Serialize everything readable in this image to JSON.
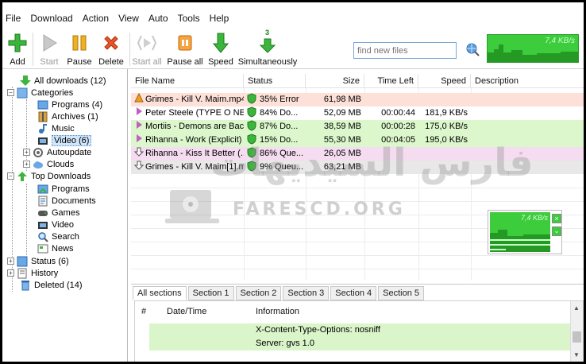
{
  "menu": [
    "File",
    "Download",
    "Action",
    "View",
    "Auto",
    "Tools",
    "Help"
  ],
  "toolbar": {
    "add": "Add",
    "start": "Start",
    "pause": "Pause",
    "delete": "Delete",
    "start_all": "Start all",
    "pause_all": "Pause all",
    "speed": "Speed",
    "simultaneously": "Simultaneously",
    "simultaneous_count": "3",
    "search_placeholder": "find new files",
    "speed_readout": "7,4 KB/s"
  },
  "sidebar": {
    "all_downloads": "All downloads (12)",
    "categories": "Categories",
    "programs": "Programs (4)",
    "archives": "Archives (1)",
    "music": "Music",
    "video": "Video (6)",
    "autoupdate": "Autoupdate",
    "clouds": "Clouds",
    "top_downloads": "Top Downloads",
    "top_programs": "Programs",
    "top_documents": "Documents",
    "top_games": "Games",
    "top_video": "Video",
    "top_search": "Search",
    "top_news": "News",
    "status": "Status (6)",
    "history": "History",
    "deleted": "Deleted (14)"
  },
  "columns": {
    "file_name": "File Name",
    "status": "Status",
    "size": "Size",
    "time_left": "Time Left",
    "speed": "Speed",
    "description": "Description"
  },
  "rows": [
    {
      "name": "Grimes - Kill V. Maim.mp4",
      "status": "35% Error",
      "size": "61,98 MB",
      "time_left": "",
      "speed": "",
      "color": "#fde0d8",
      "state": "error"
    },
    {
      "name": "Peter Steele (TYPE O NE...",
      "status": "84% Do...",
      "size": "52,09 MB",
      "time_left": "00:00:44",
      "speed": "181,9 KB/s",
      "color": "#ffffff",
      "state": "active"
    },
    {
      "name": "Mortiis - Demons are Bac...",
      "status": "87% Do...",
      "size": "38,59 MB",
      "time_left": "00:00:28",
      "speed": "175,0 KB/s",
      "color": "#dcf7cc",
      "state": "active"
    },
    {
      "name": "Rihanna - Work (Explicit) ...",
      "status": "15% Do...",
      "size": "55,30 MB",
      "time_left": "00:04:05",
      "speed": "195,0 KB/s",
      "color": "#dcf7cc",
      "state": "active"
    },
    {
      "name": "Rihanna - Kiss It Better (...",
      "status": "86% Que...",
      "size": "26,05 MB",
      "time_left": "",
      "speed": "",
      "color": "#f5dcf0",
      "state": "queued"
    },
    {
      "name": "Grimes - Kill V. Maim[1].m...",
      "status": "9% Queu...",
      "size": "63,21 MB",
      "time_left": "",
      "speed": "",
      "color": "#e8e8e8",
      "state": "queued"
    }
  ],
  "watermark": {
    "arabic": "فارس السيديهات",
    "latin": "FARESCD.ORG"
  },
  "mini_speed_readout": "7,4 KB/s",
  "tabs": [
    "All sections",
    "Section 1",
    "Section 2",
    "Section 3",
    "Section 4",
    "Section 5"
  ],
  "log": {
    "col_num": "#",
    "col_datetime": "Date/Time",
    "col_info": "Information",
    "lines": [
      "X-Content-Type-Options: nosniff",
      "Server: gvs 1.0"
    ]
  },
  "colors": {
    "graph_green": "#3ccc3c",
    "row_error": "#fde0d8",
    "row_active": "#dcf7cc",
    "row_queued": "#f5dcf0",
    "selection": "#cfe6fb"
  }
}
